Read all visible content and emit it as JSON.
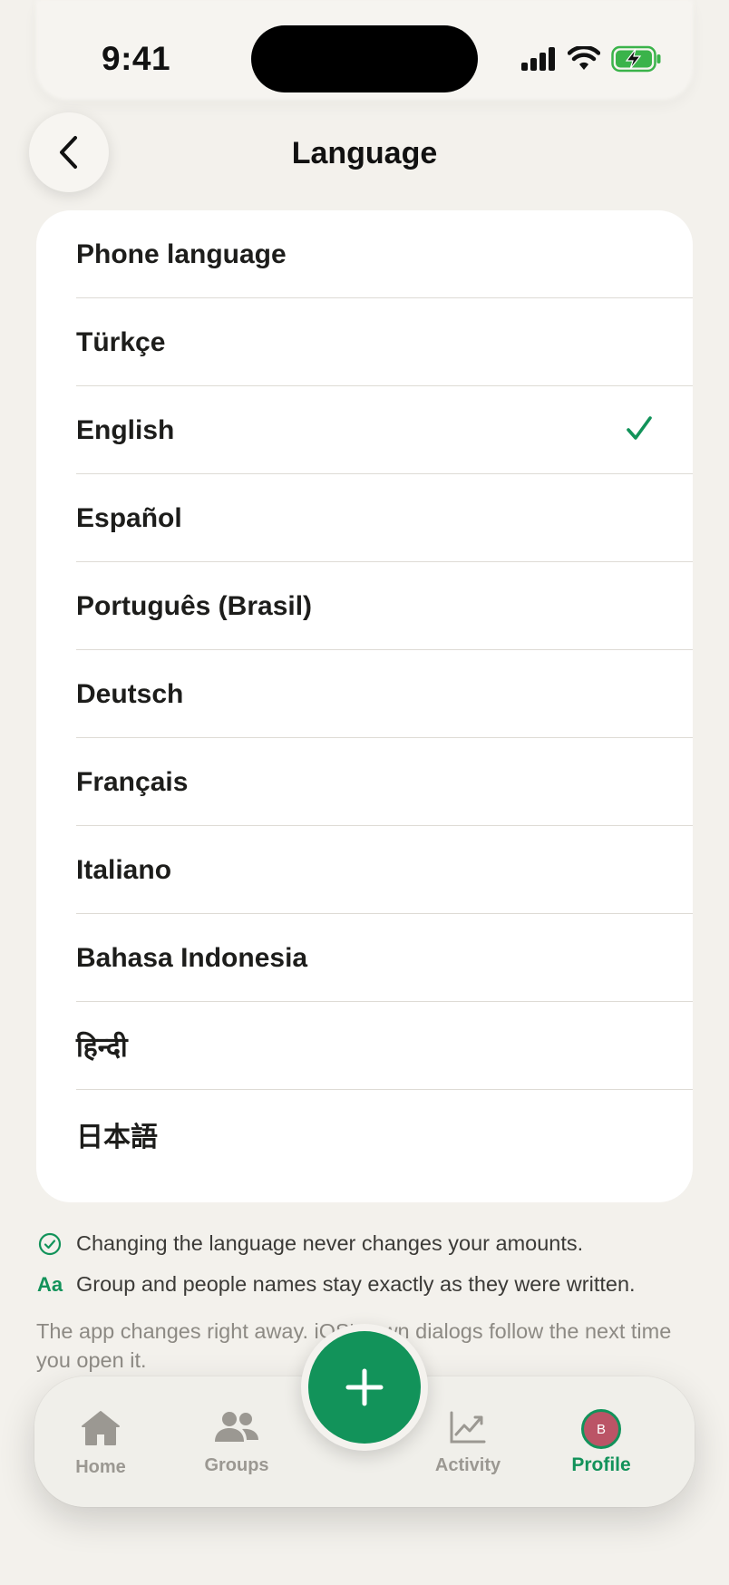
{
  "status_bar": {
    "time": "9:41"
  },
  "header": {
    "title": "Language"
  },
  "languages": [
    {
      "label": "Phone language",
      "selected": false
    },
    {
      "label": "Türkçe",
      "selected": false
    },
    {
      "label": "English",
      "selected": true
    },
    {
      "label": "Español",
      "selected": false
    },
    {
      "label": "Português (Brasil)",
      "selected": false
    },
    {
      "label": "Deutsch",
      "selected": false
    },
    {
      "label": "Français",
      "selected": false
    },
    {
      "label": "Italiano",
      "selected": false
    },
    {
      "label": "Bahasa Indonesia",
      "selected": false
    },
    {
      "label": "हिन्दी",
      "selected": false
    },
    {
      "label": "日本語",
      "selected": false
    }
  ],
  "notes": {
    "amounts": "Changing the language never changes your amounts.",
    "names_icon": "Aa",
    "names": "Group and people names stay exactly as they were written.",
    "footnote": "The app changes right away. iOS's own dialogs follow the next time you open it."
  },
  "tabbar": {
    "home": "Home",
    "groups": "Groups",
    "activity": "Activity",
    "profile": "Profile",
    "avatar_initial": "B"
  },
  "colors": {
    "accent": "#12935a",
    "background": "#f3f1ec",
    "avatar": "#bb5466"
  },
  "icons": [
    "chevron-left-icon",
    "checkmark-icon",
    "check-circle-icon",
    "home-icon",
    "groups-icon",
    "plus-icon",
    "activity-chart-icon"
  ]
}
